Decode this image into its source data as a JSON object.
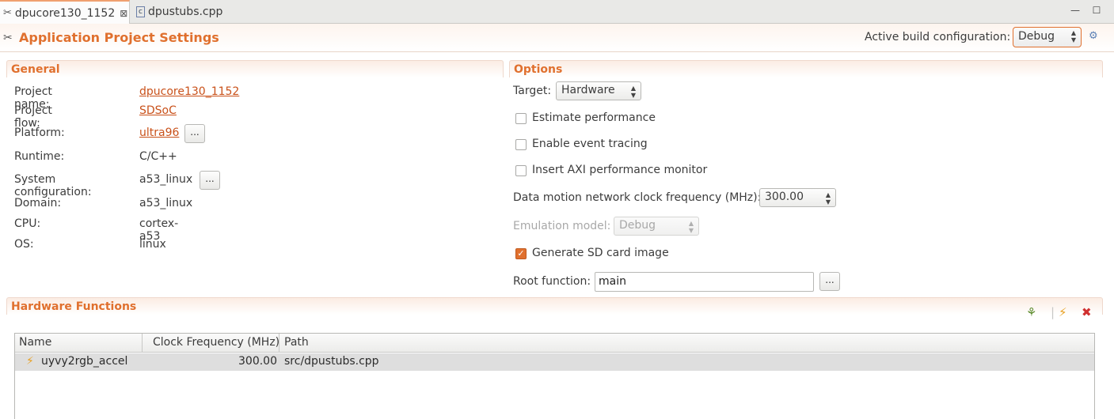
{
  "tabs": [
    {
      "label": "dpucore130_1152",
      "close": "⊠",
      "icon": "settings-icon"
    },
    {
      "label": "dpustubs.cpp",
      "icon": "cpp-file-icon"
    }
  ],
  "window": {
    "minimize": "—",
    "maximize": "☐"
  },
  "header": {
    "title": "Application Project Settings",
    "active_build_label": "Active build configuration:",
    "active_build_value": "Debug"
  },
  "general": {
    "title": "General",
    "project_name_label": "Project name:",
    "project_name_value": "dpucore130_1152",
    "project_flow_label": "Project flow:",
    "project_flow_value": "SDSoC",
    "platform_label": "Platform:",
    "platform_value": "ultra96",
    "runtime_label": "Runtime:",
    "runtime_value": "C/C++",
    "sysconfig_label": "System configuration:",
    "sysconfig_value": "a53_linux",
    "domain_label": "Domain:",
    "domain_value": "a53_linux",
    "cpu_label": "CPU:",
    "cpu_value": "cortex-a53",
    "os_label": "OS:",
    "os_value": "linux",
    "browse": "..."
  },
  "options": {
    "title": "Options",
    "target_label": "Target:",
    "target_value": "Hardware",
    "estimate_performance": {
      "label": "Estimate performance",
      "checked": false
    },
    "event_tracing": {
      "label": "Enable event tracing",
      "checked": false
    },
    "axi_monitor": {
      "label": "Insert AXI performance monitor",
      "checked": false
    },
    "clock_label": "Data motion network clock frequency (MHz):",
    "clock_value": "300.00",
    "emulation_label": "Emulation model:",
    "emulation_value": "Debug",
    "sd_card": {
      "label": "Generate SD card image",
      "checked": true,
      "mark": "✓"
    },
    "root_label": "Root function:",
    "root_value": "main",
    "browse": "..."
  },
  "hardware": {
    "title": "Hardware Functions",
    "columns": [
      "Name",
      "Clock Frequency (MHz)",
      "Path"
    ],
    "rows": [
      {
        "name": "uyvy2rgb_accel",
        "clock": "300.00",
        "path": "src/dpustubs.cpp"
      }
    ]
  },
  "colors": {
    "accent": "#e0702e",
    "link": "#c9511a",
    "selected_row": "#dedede"
  }
}
